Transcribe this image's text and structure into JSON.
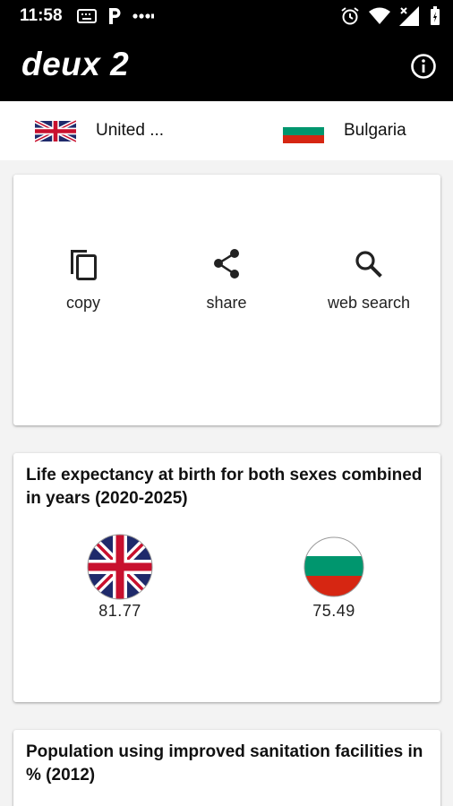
{
  "status_bar": {
    "time": "11:58",
    "left_icons": [
      "keyboard-icon",
      "parking-icon",
      "more-dots-icon"
    ],
    "right_icons": [
      "alarm-icon",
      "wifi-icon",
      "cell-signal-icon",
      "battery-icon"
    ]
  },
  "app_bar": {
    "title": "deux 2",
    "info_icon": "info-icon"
  },
  "languages": {
    "source": {
      "label": "United ...",
      "flag": "uk-flag-icon"
    },
    "target": {
      "label": "Bulgaria",
      "flag": "bulgaria-flag-icon"
    }
  },
  "actions": [
    {
      "label": "copy",
      "icon": "copy-icon"
    },
    {
      "label": "share",
      "icon": "share-icon"
    },
    {
      "label": "web search",
      "icon": "search-icon"
    }
  ],
  "stats": [
    {
      "title": "Life expectancy at birth for both sexes combined in years (2020-2025)",
      "left_value": "81.77",
      "right_value": "75.49"
    },
    {
      "title": "Population using improved sanitation facilities in % (2012)"
    }
  ],
  "colors": {
    "app_bar_bg": "#000000",
    "page_bg": "#f3f3f3",
    "card_bg": "#ffffff",
    "uk_blue": "#1f2a6b",
    "uk_red": "#c8102e",
    "bg_green": "#00966e",
    "bg_red": "#d62612"
  }
}
